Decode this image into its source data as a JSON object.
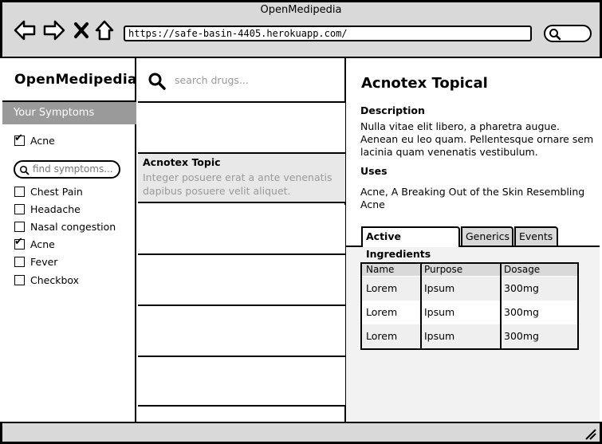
{
  "window": {
    "title": "OpenMedipedia"
  },
  "browser": {
    "url": "https://safe-basin-4405.herokuapp.com/",
    "nav_icons": [
      "back-arrow-icon",
      "forward-arrow-icon",
      "close-x-icon",
      "home-icon"
    ]
  },
  "app": {
    "title": "OpenMedipedia"
  },
  "symptoms": {
    "header": "Your Symptoms",
    "selected": {
      "label": "Acne",
      "checked": true
    },
    "search_placeholder": "find symptoms...",
    "items": [
      {
        "label": "Chest Pain",
        "checked": false
      },
      {
        "label": "Headache",
        "checked": false
      },
      {
        "label": "Nasal congestion",
        "checked": false
      },
      {
        "label": "Acne",
        "checked": true
      },
      {
        "label": "Fever",
        "checked": false
      },
      {
        "label": "Checkbox",
        "checked": false
      }
    ]
  },
  "drugs": {
    "search_placeholder": "search drugs...",
    "selected": {
      "title": "Acnotex Topic",
      "description": "Integer posuere erat a ante venenatis dapibus posuere velit aliquet."
    }
  },
  "detail": {
    "title": "Acnotex Topical",
    "description_heading": "Description",
    "description": "Nulla vitae elit libero, a pharetra augue. Aenean eu leo quam. Pellentesque ornare sem lacinia quam venenatis vestibulum.",
    "uses_heading": "Uses",
    "uses": "Acne, A Breaking Out of the Skin Resembling Acne",
    "tabs": [
      "Active Ingredients",
      "Generics",
      "Events"
    ],
    "table": {
      "headers": [
        "Name",
        "Purpose",
        "Dosage"
      ],
      "rows": [
        [
          "Lorem",
          "Ipsum",
          "300mg"
        ],
        [
          "Lorem",
          "Ipsum",
          "300mg"
        ],
        [
          "Lorem",
          "Ipsum",
          "300mg"
        ]
      ]
    }
  },
  "colors": {
    "chrome": "#d9d9d9",
    "sidebar_header": "#9a9a9a",
    "placeholder_text": "#999999",
    "selected_row": "#e8e8e8"
  }
}
